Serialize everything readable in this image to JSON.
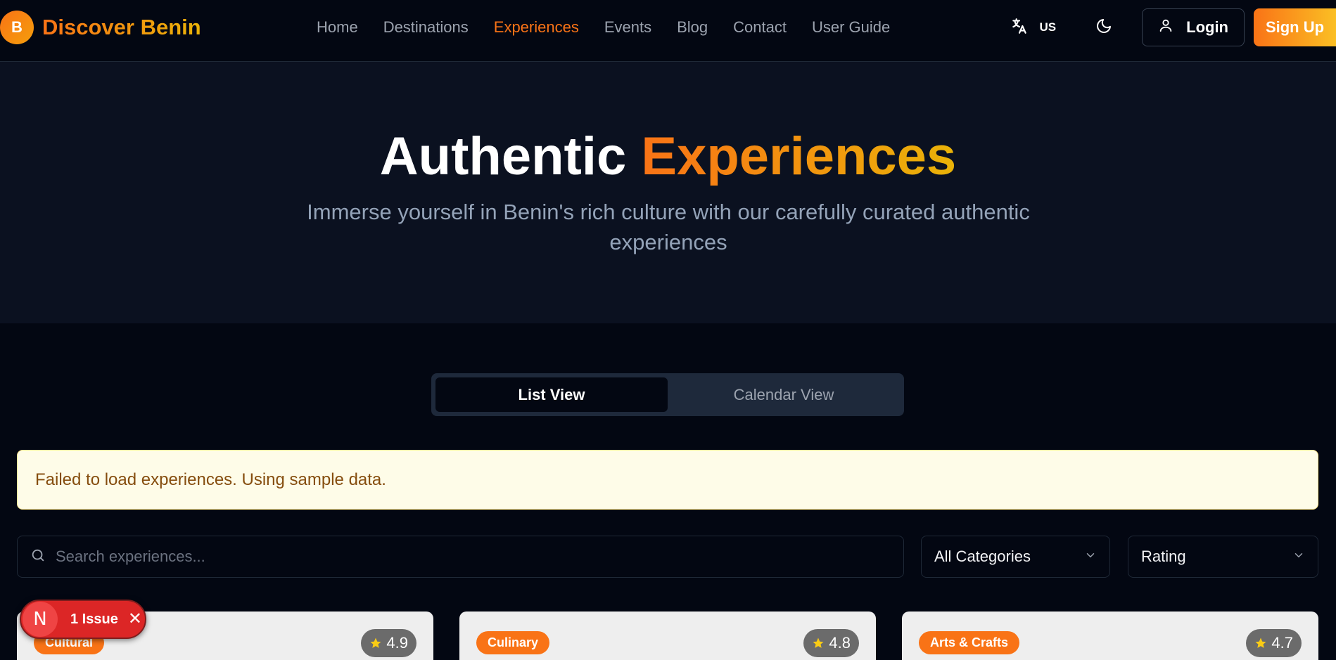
{
  "brand": {
    "logo_letter": "B",
    "name": "Discover Benin"
  },
  "nav": {
    "links": [
      "Home",
      "Destinations",
      "Experiences",
      "Events",
      "Blog",
      "Contact",
      "User Guide"
    ],
    "active": "Experiences",
    "language_code": "US",
    "login_label": "Login",
    "signup_label": "Sign Up"
  },
  "hero": {
    "title_plain": "Authentic",
    "title_accent": "Experiences",
    "subtitle": "Immerse yourself in Benin's rich culture with our carefully curated authentic experiences"
  },
  "view_toggle": {
    "list_label": "List View",
    "calendar_label": "Calendar View",
    "active": "List View"
  },
  "alert": {
    "message": "Failed to load experiences. Using sample data."
  },
  "filters": {
    "search_placeholder": "Search experiences...",
    "category_value": "All Categories",
    "sort_value": "Rating"
  },
  "cards": [
    {
      "category": "Cultural",
      "rating": "4.9"
    },
    {
      "category": "Culinary",
      "rating": "4.8"
    },
    {
      "category": "Arts & Crafts",
      "rating": "4.7"
    }
  ],
  "issue_badge": {
    "logo": "N",
    "label": "1 Issue"
  },
  "colors": {
    "accent": "#f97316",
    "accent_end": "#eab308",
    "background": "#030712",
    "alert_bg": "#fefce8"
  }
}
